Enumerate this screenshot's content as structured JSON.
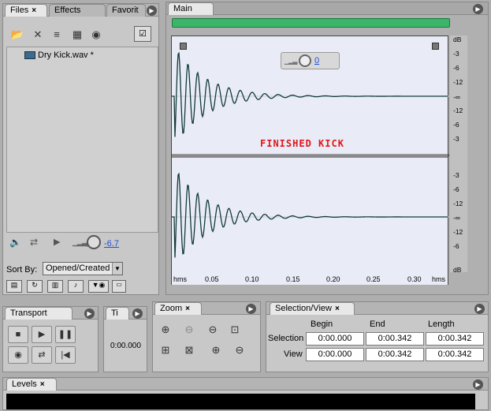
{
  "files_panel": {
    "tabs": [
      {
        "label": "Files",
        "close": "×"
      },
      {
        "label": "Effects"
      },
      {
        "label": "Favorit"
      }
    ],
    "toolbar_icons": [
      "open-file-icon",
      "close-file-icon",
      "insert-multitrack-icon",
      "insert-cd-icon",
      "autoplay-icon"
    ],
    "file_item": {
      "name": "Dry Kick.wav *"
    },
    "volume_value": "-6.7",
    "sort_by_label": "Sort By:",
    "sort_by_value": "Opened/Created"
  },
  "main_panel": {
    "tab_label": "Main",
    "overlay_volume_value": "0",
    "title_annotation": "FINISHED KICK",
    "db_labels_top": [
      "dB",
      "-3",
      "-6",
      "-12",
      "-∞",
      "-12",
      "-6",
      "-3"
    ],
    "db_labels_bottom": [
      "-3",
      "-6",
      "-12",
      "-∞",
      "-12",
      "-6",
      "dB"
    ],
    "time_ruler": {
      "start_label": "hms",
      "end_label": "hms",
      "ticks": [
        "0.05",
        "0.10",
        "0.15",
        "0.20",
        "0.25",
        "0.30"
      ]
    }
  },
  "transport_panel": {
    "tab_label": "Transport"
  },
  "time_panel": {
    "tab_label": "Ti",
    "time_value": "0:00.000"
  },
  "zoom_panel": {
    "tab_label": "Zoom",
    "close": "×"
  },
  "selection_view_panel": {
    "tab_label": "Selection/View",
    "close": "×",
    "columns": [
      "Begin",
      "End",
      "Length"
    ],
    "rows": [
      {
        "label": "Selection",
        "begin": "0:00.000",
        "end": "0:00.342",
        "length": "0:00.342"
      },
      {
        "label": "View",
        "begin": "0:00.000",
        "end": "0:00.342",
        "length": "0:00.342"
      }
    ]
  },
  "levels_panel": {
    "tab_label": "Levels",
    "close": "×"
  },
  "colors": {
    "waveform_bg": "#e9ecf6",
    "waveform_line": "#123a35",
    "annotation_red": "#e0161a",
    "overview_green": "#3cb46a",
    "link_blue": "#1f4fd8"
  }
}
